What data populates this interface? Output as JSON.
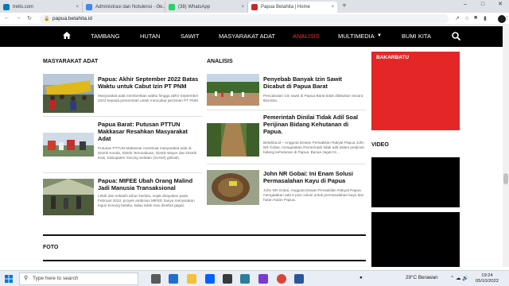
{
  "browser": {
    "tabs": [
      {
        "title": "trello.com",
        "active": false,
        "color": "#0079bf"
      },
      {
        "title": "Administrasi dan Notulensi - Go...",
        "active": false,
        "color": "#4285f4"
      },
      {
        "title": "(38) WhatsApp",
        "active": false,
        "color": "#25d366"
      },
      {
        "title": "Papua Betahita | Home",
        "active": true,
        "color": "#c62828"
      }
    ],
    "new_tab": "+",
    "url": "papua.betahita.id"
  },
  "nav": {
    "items": [
      {
        "label": "TAMBANG",
        "active": false
      },
      {
        "label": "HUTAN",
        "active": false
      },
      {
        "label": "SAWIT",
        "active": false
      },
      {
        "label": "MASYARAKAT ADAT",
        "active": false
      },
      {
        "label": "ANALISIS",
        "active": true
      },
      {
        "label": "MULTIMEDIA",
        "active": false
      },
      {
        "label": "BUMI KITA",
        "active": false
      }
    ]
  },
  "sections": {
    "masyarakat": {
      "title": "MASYARAKAT ADAT",
      "articles": [
        {
          "title": "Papua: Akhir September 2022 Batas Waktu untuk Cabut Izin PT PNM",
          "excerpt": "Masyarakat adat memberikan waktu hingga akhir September 2022 kepada pemerintah untuk mencabut perizinan PT PNM"
        },
        {
          "title": "Papua Barat: Putusan PTTUN Makkasar Resahkan Masyarakat Adat",
          "excerpt": "Putusan PTTUN Makassar membuat masyarakat adat di Distrik Konda, Distrik Teminabuan, Distrik Wayer dan Distrik Kais, Kabupaten Sorong Selatan (Sorsel) gelisah."
        },
        {
          "title": "Papua: MIFEE Ubah Orang Malind Jadi Manusia Transaksional",
          "excerpt": "Lebih dari sekasih tahun berlalu, sejak dirayakan pada Februari 2010, proyek ambisius MIFEE hanya menyisakan ingon kosong belaka, kalau tidak mau disebut gagal."
        }
      ]
    },
    "analisis": {
      "title": "ANALISIS",
      "articles": [
        {
          "title": "Penyebab Banyak Izin Sawit Dicabut di Papua Barat",
          "excerpt": "Pencabutan izin sawit di Papua Barat tidak dilakukan secara tiba-tiba."
        },
        {
          "title": "Pemerintah Dinilai Tidak Adil Soal Perijinan Bidang Kehutanan di Papua.",
          "excerpt": "Betahita.id – Anggota Dewan Perwakilan Rakyat Papua John NR Gobai, mengatakan Pemerintah tidak adil dalam perijinan bidang kehutanan di Papua. Bacaa Jagat Ini..."
        },
        {
          "title": "John NR Gobai: Ini Enam Solusi Permasalahan Kayu di Papua",
          "excerpt": "John NR Gobai, Anggota Dewan Perwakilan Rakyat Papua mengatakan ada 6 poin solusi untuk permasalahan kayu dan hutan hutan Papua."
        }
      ]
    },
    "sidebar": {
      "bakarbatu": "BAKARBATU",
      "video": "VIDEO"
    },
    "foto": "FOTO"
  },
  "taskbar": {
    "search_placeholder": "Type here to search",
    "weather": "29°C  Berawan",
    "time": "19:24",
    "date": "05/10/2022"
  }
}
